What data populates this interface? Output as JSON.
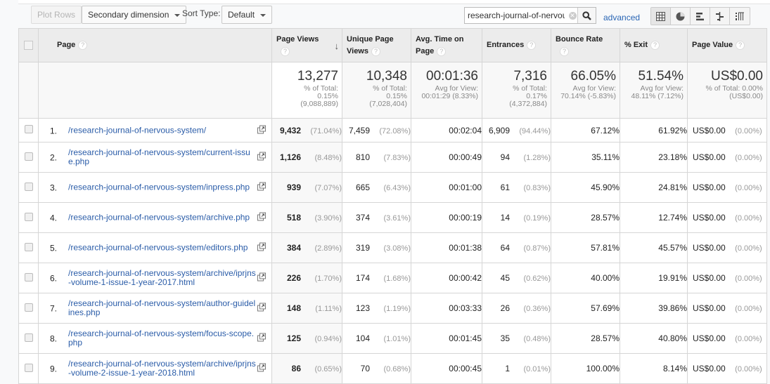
{
  "toolbar": {
    "plot_rows": "Plot Rows",
    "secondary_dimension": "Secondary dimension",
    "sort_type_label": "Sort Type:",
    "sort_type_value": "Default",
    "search_value": "research-journal-of-nervou",
    "advanced": "advanced",
    "view_icons": [
      "table-view-icon",
      "pie-view-icon",
      "performance-view-icon",
      "comparison-view-icon",
      "pivot-view-icon"
    ]
  },
  "columns": {
    "page": "Page",
    "page_views": "Page Views",
    "unique_page_views": "Unique Page Views",
    "avg_time": "Avg. Time on Page",
    "entrances": "Entrances",
    "bounce_rate": "Bounce Rate",
    "exit": "% Exit",
    "page_value": "Page Value",
    "help": "?",
    "sort_indicator": "↓"
  },
  "summary": {
    "page_views": {
      "value": "13,277",
      "line1": "% of Total:",
      "line2": "0.15%",
      "line3": "(9,088,889)"
    },
    "unique_page_views": {
      "value": "10,348",
      "line1": "% of Total:",
      "line2": "0.15%",
      "line3": "(7,028,404)"
    },
    "avg_time": {
      "value": "00:01:36",
      "line1": "Avg for View:",
      "line2": "00:01:29 (8.33%)"
    },
    "entrances": {
      "value": "7,316",
      "line1": "% of Total:",
      "line2": "0.17%",
      "line3": "(4,372,884)"
    },
    "bounce_rate": {
      "value": "66.05%",
      "line1": "Avg for View:",
      "line2": "70.14% (-5.83%)"
    },
    "exit": {
      "value": "51.54%",
      "line1": "Avg for View:",
      "line2": "48.11% (7.12%)"
    },
    "page_value": {
      "value": "US$0.00",
      "line1": "% of Total: 0.00%",
      "line2": "(US$0.00)"
    }
  },
  "rows": [
    {
      "index": "1.",
      "page": "/research-journal-of-nervous-system/",
      "pv": "9,432",
      "pv_pct": "(71.04%)",
      "upv": "7,459",
      "upv_pct": "(72.08%)",
      "avg_time": "00:02:04",
      "ent": "6,909",
      "ent_pct": "(94.44%)",
      "bounce": "67.12%",
      "exit": "61.92%",
      "value": "US$0.00",
      "value_pct": "(0.00%)"
    },
    {
      "index": "2.",
      "page": "/research-journal-of-nervous-system/current-issue.php",
      "pv": "1,126",
      "pv_pct": "(8.48%)",
      "upv": "810",
      "upv_pct": "(7.83%)",
      "avg_time": "00:00:49",
      "ent": "94",
      "ent_pct": "(1.28%)",
      "bounce": "35.11%",
      "exit": "23.18%",
      "value": "US$0.00",
      "value_pct": "(0.00%)"
    },
    {
      "index": "3.",
      "page": "/research-journal-of-nervous-system/inpress.php",
      "pv": "939",
      "pv_pct": "(7.07%)",
      "upv": "665",
      "upv_pct": "(6.43%)",
      "avg_time": "00:01:00",
      "ent": "61",
      "ent_pct": "(0.83%)",
      "bounce": "45.90%",
      "exit": "24.81%",
      "value": "US$0.00",
      "value_pct": "(0.00%)"
    },
    {
      "index": "4.",
      "page": "/research-journal-of-nervous-system/archive.php",
      "pv": "518",
      "pv_pct": "(3.90%)",
      "upv": "374",
      "upv_pct": "(3.61%)",
      "avg_time": "00:00:19",
      "ent": "14",
      "ent_pct": "(0.19%)",
      "bounce": "28.57%",
      "exit": "12.74%",
      "value": "US$0.00",
      "value_pct": "(0.00%)"
    },
    {
      "index": "5.",
      "page": "/research-journal-of-nervous-system/editors.php",
      "pv": "384",
      "pv_pct": "(2.89%)",
      "upv": "319",
      "upv_pct": "(3.08%)",
      "avg_time": "00:01:38",
      "ent": "64",
      "ent_pct": "(0.87%)",
      "bounce": "57.81%",
      "exit": "45.57%",
      "value": "US$0.00",
      "value_pct": "(0.00%)"
    },
    {
      "index": "6.",
      "page": "/research-journal-of-nervous-system/archive/iprjns-volume-1-issue-1-year-2017.html",
      "pv": "226",
      "pv_pct": "(1.70%)",
      "upv": "174",
      "upv_pct": "(1.68%)",
      "avg_time": "00:00:42",
      "ent": "45",
      "ent_pct": "(0.62%)",
      "bounce": "40.00%",
      "exit": "19.91%",
      "value": "US$0.00",
      "value_pct": "(0.00%)"
    },
    {
      "index": "7.",
      "page": "/research-journal-of-nervous-system/author-guidelines.php",
      "pv": "148",
      "pv_pct": "(1.11%)",
      "upv": "123",
      "upv_pct": "(1.19%)",
      "avg_time": "00:03:33",
      "ent": "26",
      "ent_pct": "(0.36%)",
      "bounce": "57.69%",
      "exit": "39.86%",
      "value": "US$0.00",
      "value_pct": "(0.00%)"
    },
    {
      "index": "8.",
      "page": "/research-journal-of-nervous-system/focus-scope.php",
      "pv": "125",
      "pv_pct": "(0.94%)",
      "upv": "104",
      "upv_pct": "(1.01%)",
      "avg_time": "00:01:45",
      "ent": "35",
      "ent_pct": "(0.48%)",
      "bounce": "28.57%",
      "exit": "40.80%",
      "value": "US$0.00",
      "value_pct": "(0.00%)"
    },
    {
      "index": "9.",
      "page": "/research-journal-of-nervous-system/archive/iprjns-volume-2-issue-1-year-2018.html",
      "pv": "86",
      "pv_pct": "(0.65%)",
      "upv": "70",
      "upv_pct": "(0.68%)",
      "avg_time": "00:00:45",
      "ent": "1",
      "ent_pct": "(0.01%)",
      "bounce": "100.00%",
      "exit": "8.14%",
      "value": "US$0.00",
      "value_pct": "(0.00%)"
    }
  ]
}
